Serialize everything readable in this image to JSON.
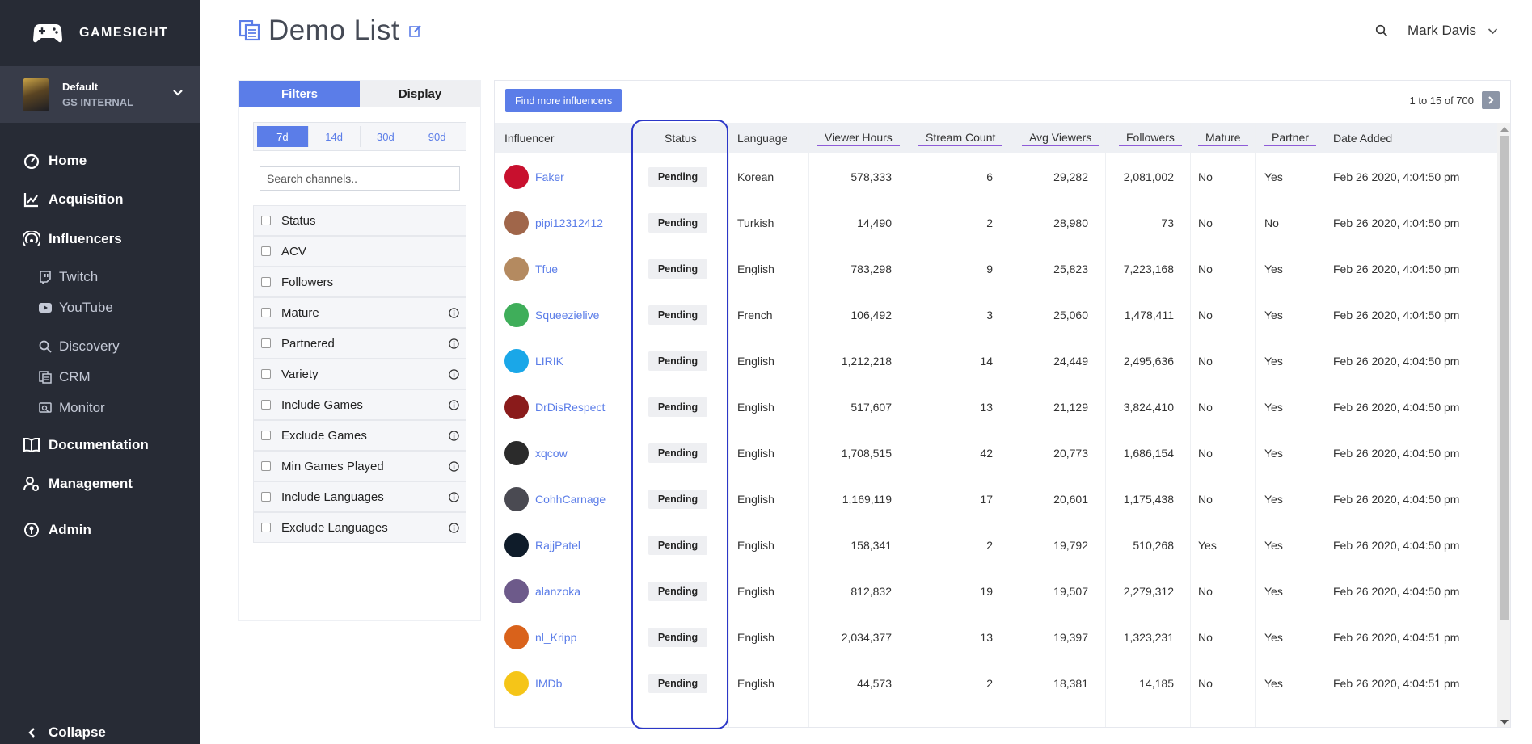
{
  "brand": {
    "name": "GAMESIGHT"
  },
  "org": {
    "name": "Default",
    "sub": "GS INTERNAL"
  },
  "nav": {
    "home": "Home",
    "acquisition": "Acquisition",
    "influencers": "Influencers",
    "twitch": "Twitch",
    "youtube": "YouTube",
    "discovery": "Discovery",
    "crm": "CRM",
    "monitor": "Monitor",
    "documentation": "Documentation",
    "management": "Management",
    "admin": "Admin",
    "collapse": "Collapse"
  },
  "header": {
    "title": "Demo List",
    "user": "Mark Davis"
  },
  "filters": {
    "tabs": [
      "Filters",
      "Display"
    ],
    "periods": [
      "7d",
      "14d",
      "30d",
      "90d"
    ],
    "search_placeholder": "Search channels..",
    "items": [
      "Status",
      "ACV",
      "Followers",
      "Mature",
      "Partnered",
      "Variety",
      "Include Games",
      "Exclude Games",
      "Min Games Played",
      "Include Languages",
      "Exclude Languages"
    ]
  },
  "table": {
    "find_button": "Find more influencers",
    "pager": "1 to 15 of 700",
    "headers": {
      "influencer": "Influencer",
      "status": "Status",
      "language": "Language",
      "viewer_hours": "Viewer Hours",
      "stream_count": "Stream Count",
      "avg_viewers": "Avg Viewers",
      "followers": "Followers",
      "mature": "Mature",
      "partner": "Partner",
      "date_added": "Date Added"
    },
    "rows": [
      {
        "name": "Faker",
        "status": "Pending",
        "language": "Korean",
        "viewer_hours": "578,333",
        "stream_count": "6",
        "avg_viewers": "29,282",
        "followers": "2,081,002",
        "mature": "No",
        "partner": "Yes",
        "date": "Feb 26 2020, 4:04:50 pm",
        "avatar_color": "#c8102e"
      },
      {
        "name": "pipi12312412",
        "status": "Pending",
        "language": "Turkish",
        "viewer_hours": "14,490",
        "stream_count": "2",
        "avg_viewers": "28,980",
        "followers": "73",
        "mature": "No",
        "partner": "No",
        "date": "Feb 26 2020, 4:04:50 pm",
        "avatar_color": "#a0664a"
      },
      {
        "name": "Tfue",
        "status": "Pending",
        "language": "English",
        "viewer_hours": "783,298",
        "stream_count": "9",
        "avg_viewers": "25,823",
        "followers": "7,223,168",
        "mature": "No",
        "partner": "Yes",
        "date": "Feb 26 2020, 4:04:50 pm",
        "avatar_color": "#b48a60"
      },
      {
        "name": "Squeezielive",
        "status": "Pending",
        "language": "French",
        "viewer_hours": "106,492",
        "stream_count": "3",
        "avg_viewers": "25,060",
        "followers": "1,478,411",
        "mature": "No",
        "partner": "Yes",
        "date": "Feb 26 2020, 4:04:50 pm",
        "avatar_color": "#3fae5a"
      },
      {
        "name": "LIRIK",
        "status": "Pending",
        "language": "English",
        "viewer_hours": "1,212,218",
        "stream_count": "14",
        "avg_viewers": "24,449",
        "followers": "2,495,636",
        "mature": "No",
        "partner": "Yes",
        "date": "Feb 26 2020, 4:04:50 pm",
        "avatar_color": "#1aa7e8"
      },
      {
        "name": "DrDisRespect",
        "status": "Pending",
        "language": "English",
        "viewer_hours": "517,607",
        "stream_count": "13",
        "avg_viewers": "21,129",
        "followers": "3,824,410",
        "mature": "No",
        "partner": "Yes",
        "date": "Feb 26 2020, 4:04:50 pm",
        "avatar_color": "#8a1b1b"
      },
      {
        "name": "xqcow",
        "status": "Pending",
        "language": "English",
        "viewer_hours": "1,708,515",
        "stream_count": "42",
        "avg_viewers": "20,773",
        "followers": "1,686,154",
        "mature": "No",
        "partner": "Yes",
        "date": "Feb 26 2020, 4:04:50 pm",
        "avatar_color": "#2b2b2b"
      },
      {
        "name": "CohhCarnage",
        "status": "Pending",
        "language": "English",
        "viewer_hours": "1,169,119",
        "stream_count": "17",
        "avg_viewers": "20,601",
        "followers": "1,175,438",
        "mature": "No",
        "partner": "Yes",
        "date": "Feb 26 2020, 4:04:50 pm",
        "avatar_color": "#4a4a52"
      },
      {
        "name": "RajjPatel",
        "status": "Pending",
        "language": "English",
        "viewer_hours": "158,341",
        "stream_count": "2",
        "avg_viewers": "19,792",
        "followers": "510,268",
        "mature": "Yes",
        "partner": "Yes",
        "date": "Feb 26 2020, 4:04:50 pm",
        "avatar_color": "#0f1c2a"
      },
      {
        "name": "alanzoka",
        "status": "Pending",
        "language": "English",
        "viewer_hours": "812,832",
        "stream_count": "19",
        "avg_viewers": "19,507",
        "followers": "2,279,312",
        "mature": "No",
        "partner": "Yes",
        "date": "Feb 26 2020, 4:04:50 pm",
        "avatar_color": "#6d5a8a"
      },
      {
        "name": "nl_Kripp",
        "status": "Pending",
        "language": "English",
        "viewer_hours": "2,034,377",
        "stream_count": "13",
        "avg_viewers": "19,397",
        "followers": "1,323,231",
        "mature": "No",
        "partner": "Yes",
        "date": "Feb 26 2020, 4:04:51 pm",
        "avatar_color": "#d9621b"
      },
      {
        "name": "IMDb",
        "status": "Pending",
        "language": "English",
        "viewer_hours": "44,573",
        "stream_count": "2",
        "avg_viewers": "18,381",
        "followers": "14,185",
        "mature": "No",
        "partner": "Yes",
        "date": "Feb 26 2020, 4:04:51 pm",
        "avatar_color": "#f5c518"
      }
    ]
  }
}
